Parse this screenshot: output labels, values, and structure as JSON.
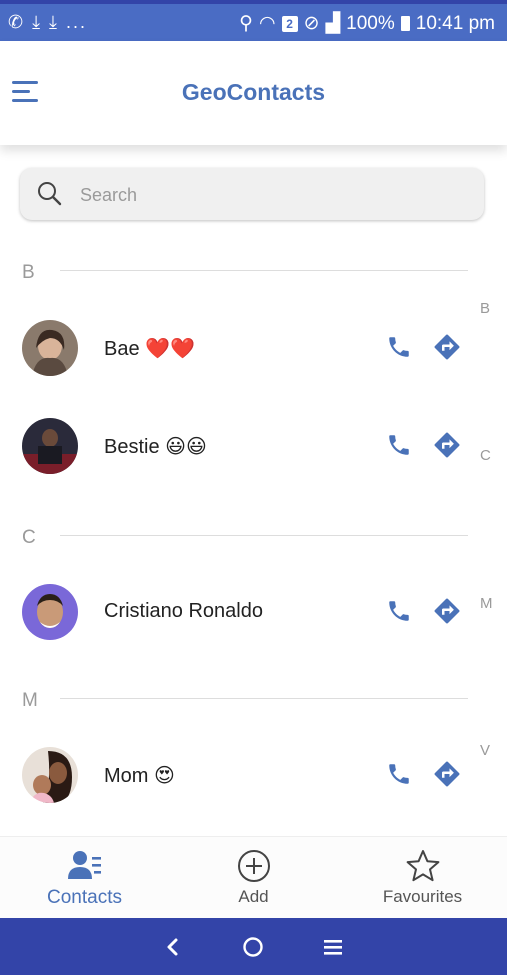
{
  "status_bar": {
    "left_icons": "✆ ⤓ ⤓ ...",
    "signal_badge": "2",
    "battery": "100%",
    "time": "10:41 pm"
  },
  "app_bar": {
    "title": "GeoContacts"
  },
  "search": {
    "placeholder": "Search"
  },
  "sections": [
    {
      "letter": "B"
    },
    {
      "letter": "C"
    },
    {
      "letter": "M"
    }
  ],
  "contacts": [
    {
      "name": "Bae ❤️❤️"
    },
    {
      "name": "Bestie 😃😃"
    },
    {
      "name": "Cristiano Ronaldo"
    },
    {
      "name": "Mom 😍"
    }
  ],
  "index": [
    "B",
    "C",
    "M",
    "V"
  ],
  "bottom_nav": {
    "tabs": [
      {
        "label": "Contacts",
        "icon": "contacts-icon",
        "active": true
      },
      {
        "label": "Add",
        "icon": "add-circle-icon",
        "active": false
      },
      {
        "label": "Favourites",
        "icon": "star-icon",
        "active": false
      }
    ]
  },
  "colors": {
    "accent": "#4a72b8",
    "status_bar": "#4a6cc4",
    "nav_bar": "#3344a8"
  }
}
